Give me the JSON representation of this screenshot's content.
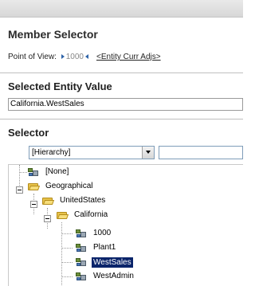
{
  "panel": {
    "title": "Member Selector",
    "pov_label": "Point of View:",
    "pov_value": "1000",
    "pov_link": "<Entity Curr Adjs>"
  },
  "selected_entity": {
    "heading": "Selected Entity Value",
    "value": "California.WestSales"
  },
  "selector": {
    "heading": "Selector",
    "hierarchy_option": "[Hierarchy]",
    "search_value": ""
  },
  "tree": {
    "none": "[None]",
    "geographical": "Geographical",
    "unitedstates": "UnitedStates",
    "california": "California",
    "leaf_1000": "1000",
    "plant1": "Plant1",
    "westsales": "WestSales",
    "westadmin": "WestAdmin"
  }
}
